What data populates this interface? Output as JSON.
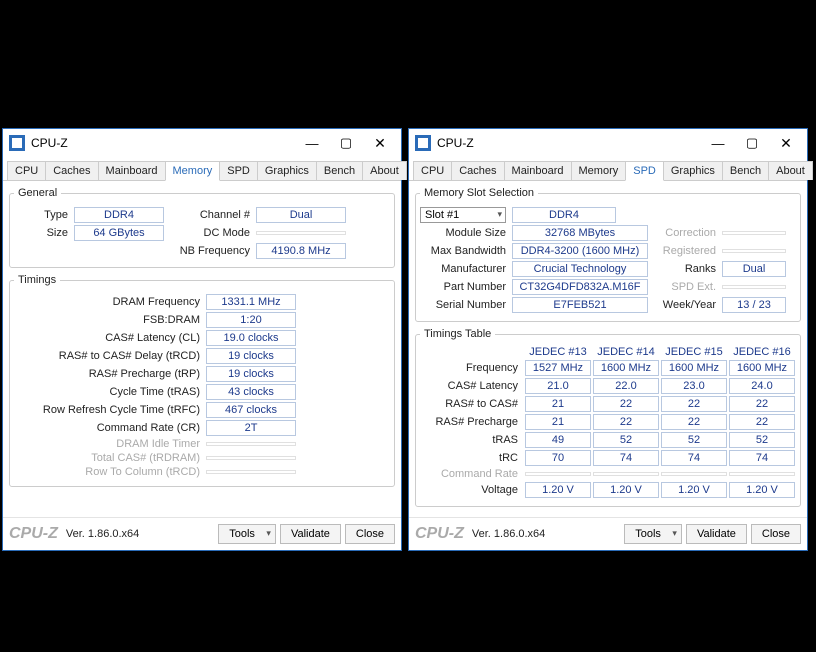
{
  "left": {
    "title": "CPU-Z",
    "tabs": [
      "CPU",
      "Caches",
      "Mainboard",
      "Memory",
      "SPD",
      "Graphics",
      "Bench",
      "About"
    ],
    "active_tab": "Memory",
    "general_legend": "General",
    "timings_legend": "Timings",
    "general": {
      "type_label": "Type",
      "type": "DDR4",
      "size_label": "Size",
      "size": "64 GBytes",
      "channel_label": "Channel #",
      "channel": "Dual",
      "dcmode_label": "DC Mode",
      "nbfreq_label": "NB Frequency",
      "nbfreq": "4190.8 MHz"
    },
    "timings": [
      {
        "label": "DRAM Frequency",
        "value": "1331.1 MHz"
      },
      {
        "label": "FSB:DRAM",
        "value": "1:20"
      },
      {
        "label": "CAS# Latency (CL)",
        "value": "19.0 clocks"
      },
      {
        "label": "RAS# to CAS# Delay (tRCD)",
        "value": "19 clocks"
      },
      {
        "label": "RAS# Precharge (tRP)",
        "value": "19 clocks"
      },
      {
        "label": "Cycle Time (tRAS)",
        "value": "43 clocks"
      },
      {
        "label": "Row Refresh Cycle Time (tRFC)",
        "value": "467 clocks"
      },
      {
        "label": "Command Rate (CR)",
        "value": "2T"
      },
      {
        "label": "DRAM Idle Timer",
        "value": "",
        "dim": true
      },
      {
        "label": "Total CAS# (tRDRAM)",
        "value": "",
        "dim": true
      },
      {
        "label": "Row To Column (tRCD)",
        "value": "",
        "dim": true
      }
    ]
  },
  "right": {
    "title": "CPU-Z",
    "tabs": [
      "CPU",
      "Caches",
      "Mainboard",
      "Memory",
      "SPD",
      "Graphics",
      "Bench",
      "About"
    ],
    "active_tab": "SPD",
    "slot_legend": "Memory Slot Selection",
    "tt_legend": "Timings Table",
    "slot": {
      "slot_sel": "Slot #1",
      "type": "DDR4",
      "rows": [
        {
          "l": "Module Size",
          "v": "32768 MBytes",
          "rl": "Correction",
          "rv": ""
        },
        {
          "l": "Max Bandwidth",
          "v": "DDR4-3200 (1600 MHz)",
          "rl": "Registered",
          "rv": ""
        },
        {
          "l": "Manufacturer",
          "v": "Crucial Technology",
          "rl": "Ranks",
          "rv": "Dual"
        },
        {
          "l": "Part Number",
          "v": "CT32G4DFD832A.M16F",
          "rl": "SPD Ext.",
          "rv": ""
        },
        {
          "l": "Serial Number",
          "v": "E7FEB521",
          "rl": "Week/Year",
          "rv": "13 / 23"
        }
      ]
    },
    "tt_headers": [
      "JEDEC #13",
      "JEDEC #14",
      "JEDEC #15",
      "JEDEC #16"
    ],
    "tt_rows": [
      {
        "label": "Frequency",
        "v": [
          "1527 MHz",
          "1600 MHz",
          "1600 MHz",
          "1600 MHz"
        ]
      },
      {
        "label": "CAS# Latency",
        "v": [
          "21.0",
          "22.0",
          "23.0",
          "24.0"
        ]
      },
      {
        "label": "RAS# to CAS#",
        "v": [
          "21",
          "22",
          "22",
          "22"
        ]
      },
      {
        "label": "RAS# Precharge",
        "v": [
          "21",
          "22",
          "22",
          "22"
        ]
      },
      {
        "label": "tRAS",
        "v": [
          "49",
          "52",
          "52",
          "52"
        ]
      },
      {
        "label": "tRC",
        "v": [
          "70",
          "74",
          "74",
          "74"
        ]
      },
      {
        "label": "Command Rate",
        "v": [
          "",
          "",
          "",
          ""
        ],
        "dim": true
      },
      {
        "label": "Voltage",
        "v": [
          "1.20 V",
          "1.20 V",
          "1.20 V",
          "1.20 V"
        ]
      }
    ]
  },
  "footer": {
    "brand": "CPU-Z",
    "version": "Ver. 1.86.0.x64",
    "tools": "Tools",
    "validate": "Validate",
    "close": "Close"
  }
}
